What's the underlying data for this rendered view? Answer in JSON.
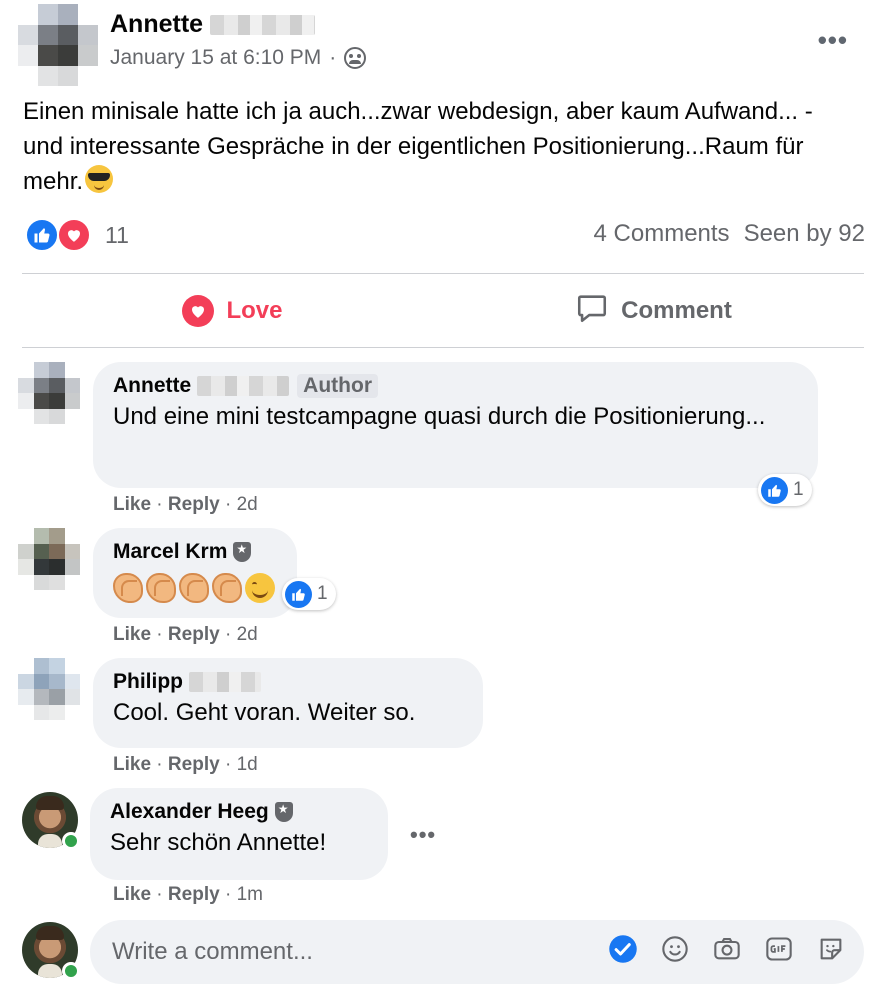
{
  "post": {
    "author_name": "Annette",
    "timestamp": "January 15 at 6:10 PM",
    "meta_separator": "·",
    "audience_icon": "friends-icon",
    "more_label": "•••",
    "text": "Einen minisale hatte ich ja auch...zwar webdesign, aber kaum Aufwand... - und interessante Gespräche in der eigentlichen Positionierung...Raum für mehr.",
    "reactions_count": "11",
    "comments_label": "4 Comments",
    "seen_label": "Seen by 92"
  },
  "actions": {
    "love_label": "Love",
    "comment_label": "Comment"
  },
  "comments": [
    {
      "name": "Annette",
      "badge": "Author",
      "text": "Und eine mini testcampagne quasi durch die Positionierung...",
      "like": "Like",
      "reply": "Reply",
      "time": "2d",
      "reaction_count": "1"
    },
    {
      "name": "Marcel Krm",
      "text": "",
      "like": "Like",
      "reply": "Reply",
      "time": "2d",
      "reaction_count": "1"
    },
    {
      "name": "Philipp",
      "text": "Cool. Geht voran. Weiter so.",
      "like": "Like",
      "reply": "Reply",
      "time": "1d"
    },
    {
      "name": "Alexander Heeg",
      "text": "Sehr schön Annette!",
      "like": "Like",
      "reply": "Reply",
      "time": "1m",
      "more_label": "•••"
    }
  ],
  "composer": {
    "placeholder": "Write a comment..."
  },
  "colors": {
    "like_blue": "#1877f2",
    "love_red": "#f33e58",
    "muted_text": "#65676b",
    "bubble_bg": "#f0f2f5",
    "online_green": "#31a24c"
  }
}
